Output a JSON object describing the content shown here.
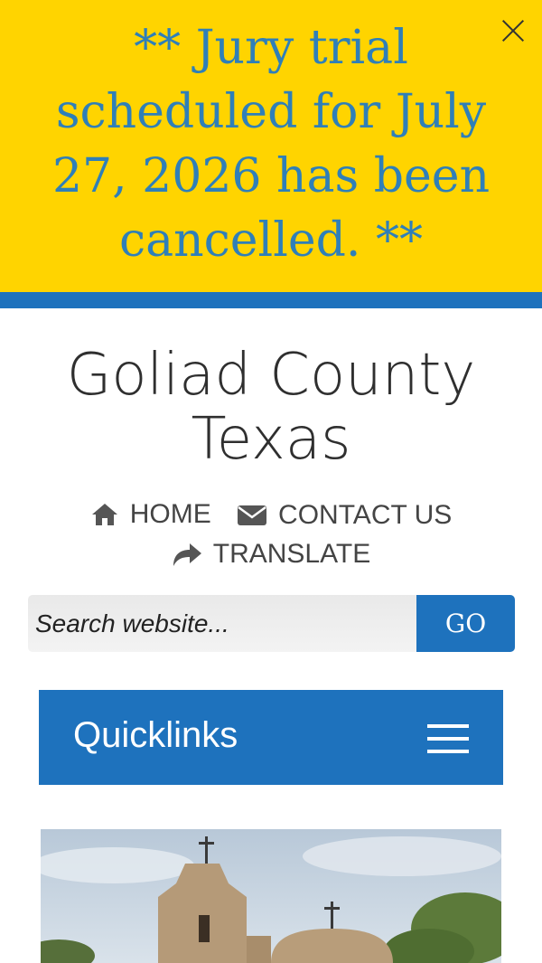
{
  "alert": {
    "message": "** Jury trial scheduled for July 27, 2026 has been cancelled. **",
    "close_icon": "close-icon"
  },
  "site": {
    "title_line1": "Goliad County",
    "title_line2": "Texas"
  },
  "nav": {
    "home": "HOME",
    "contact": "CONTACT US",
    "translate": "TRANSLATE"
  },
  "search": {
    "placeholder": "Search website...",
    "button": "GO"
  },
  "quicklinks": {
    "label": "Quicklinks"
  },
  "colors": {
    "alert_bg": "#ffd400",
    "alert_text": "#2f7fb8",
    "brand_blue": "#1e72bd"
  }
}
